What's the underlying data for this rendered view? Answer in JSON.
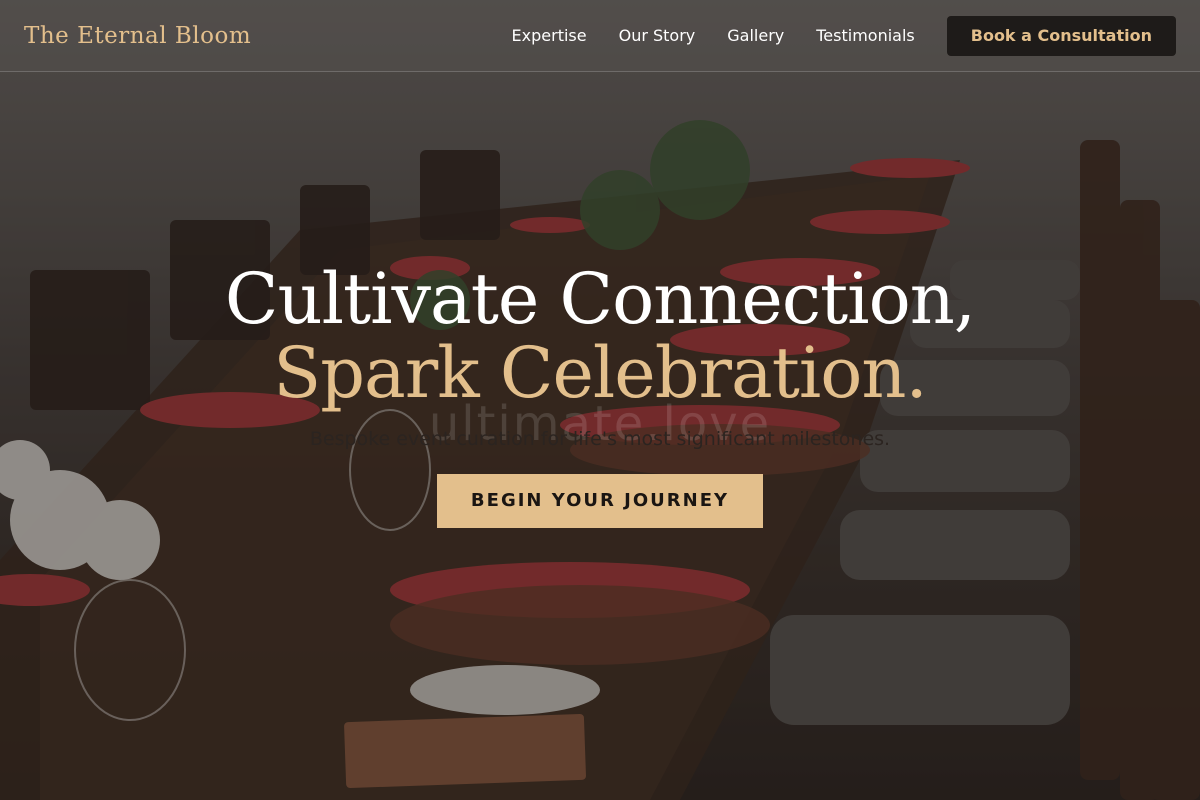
{
  "brand": {
    "name": "The Eternal Bloom"
  },
  "nav": {
    "links": [
      "Expertise",
      "Our Story",
      "Gallery",
      "Testimonials"
    ],
    "cta_label": "Book a Consultation"
  },
  "hero": {
    "headline_line1": "Cultivate Connection,",
    "headline_line2": "Spark Celebration.",
    "subtitle": "Bespoke event curation for life's most significant milestones.",
    "cta_label": "BEGIN YOUR JOURNEY",
    "watermark": "ultimate.love"
  },
  "colors": {
    "accent": "#e3bf8c",
    "dark": "#1e1b19",
    "napkin": "#b83a3a"
  },
  "background": {
    "scene": "outdoor banquet table with red napkins and wooden chairs"
  }
}
